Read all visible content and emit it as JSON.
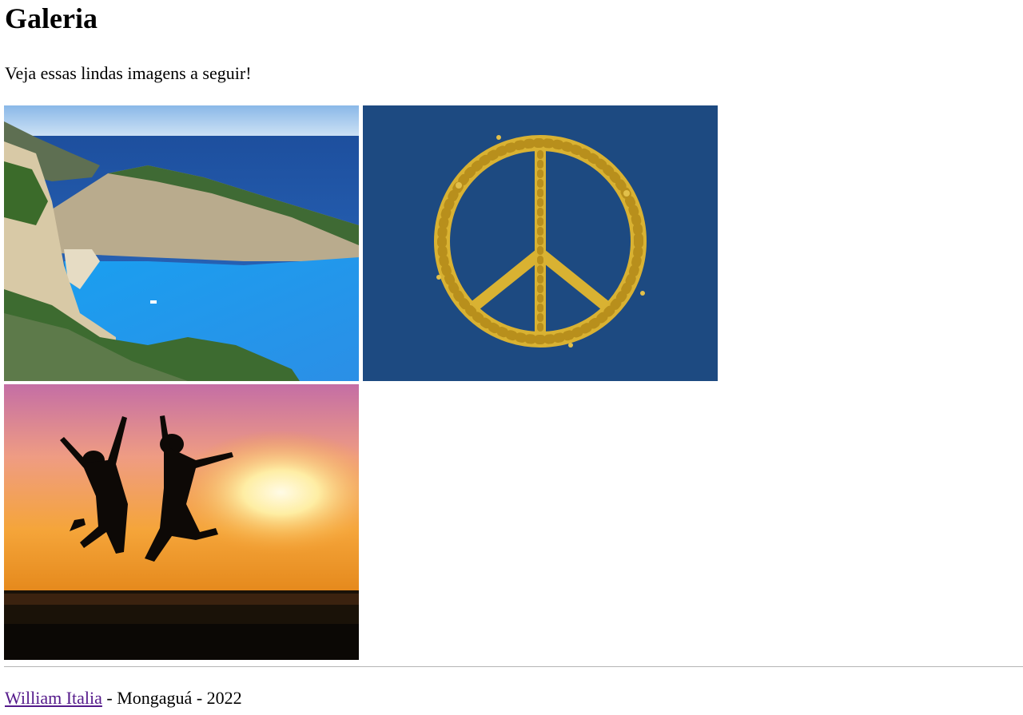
{
  "page": {
    "title": "Galeria",
    "intro": "Veja essas lindas imagens a seguir!"
  },
  "gallery": {
    "images": [
      {
        "subject": "beach-cove-photo"
      },
      {
        "subject": "flower-peace-sign-photo"
      },
      {
        "subject": "sunset-jumping-silhouettes-photo"
      }
    ]
  },
  "footer": {
    "author_link": "William Italia",
    "rest": " - Mongaguá - 2022"
  },
  "colors": {
    "link_visited": "#551a8b",
    "rule": "#b5b5b5"
  }
}
